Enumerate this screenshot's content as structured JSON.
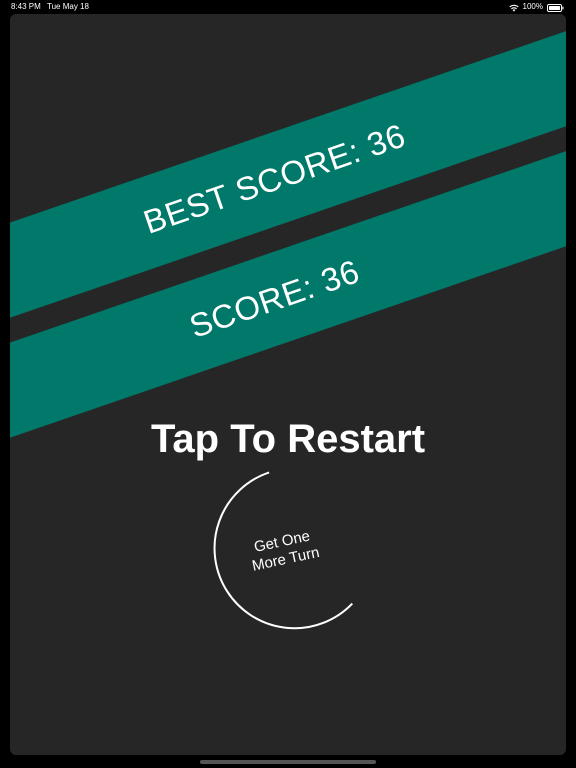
{
  "status_bar": {
    "time": "8:43 PM",
    "date": "Tue May 18",
    "battery": "100%"
  },
  "game": {
    "best_score_label": "BEST SCORE: 36",
    "score_label": "SCORE: 36",
    "restart_label": "Tap To Restart",
    "turn_button_line1": "Get One",
    "turn_button_line2": "More Turn"
  },
  "colors": {
    "background": "#262626",
    "band": "#00796b",
    "text": "#ffffff"
  }
}
